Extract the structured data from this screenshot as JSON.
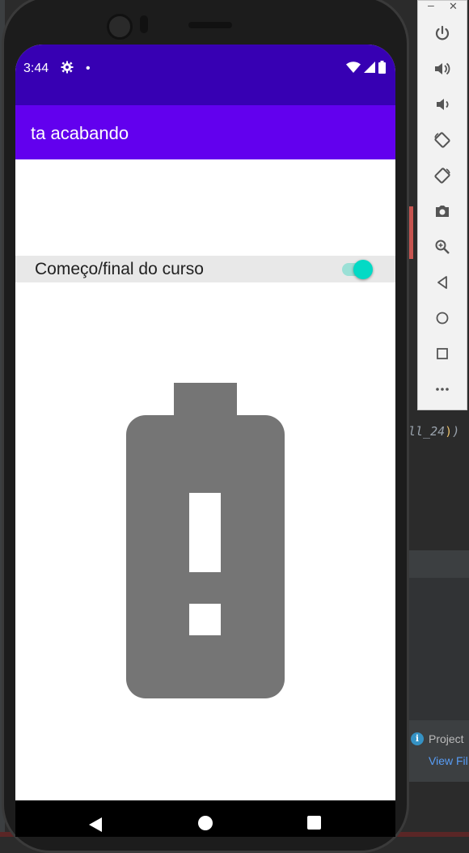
{
  "status_bar": {
    "time": "3:44",
    "icons": [
      "gear-icon",
      "notification-dot-icon",
      "wifi-icon",
      "signal-icon",
      "battery-icon"
    ]
  },
  "app_bar": {
    "title": "ta acabando"
  },
  "toggle": {
    "label": "Começo/final do curso",
    "checked": true,
    "accent_color": "#03dac5"
  },
  "content": {
    "image_icon": "battery-alert-icon",
    "image_color": "#757575"
  },
  "navigation": [
    "back-icon",
    "home-icon",
    "recents-icon"
  ],
  "emulator_toolbar": {
    "window_controls": [
      "minimize-icon",
      "close-icon"
    ],
    "buttons": [
      "power-icon",
      "volume-up-icon",
      "volume-down-icon",
      "rotate-left-icon",
      "rotate-right-icon",
      "camera-icon",
      "zoom-icon",
      "back-icon",
      "home-icon",
      "overview-icon",
      "more-icon"
    ]
  },
  "ide": {
    "code_fragment": "ll_24",
    "code_paren": ")",
    "code_tail": ")",
    "notification_title": "Project",
    "notification_link": "View Fil",
    "colors": {
      "background": "#2b2b2b",
      "link": "#589df6"
    }
  },
  "colors": {
    "status_bar": "#3700b3",
    "app_bar": "#6200ee",
    "toggle_row": "#e8e8e8"
  }
}
